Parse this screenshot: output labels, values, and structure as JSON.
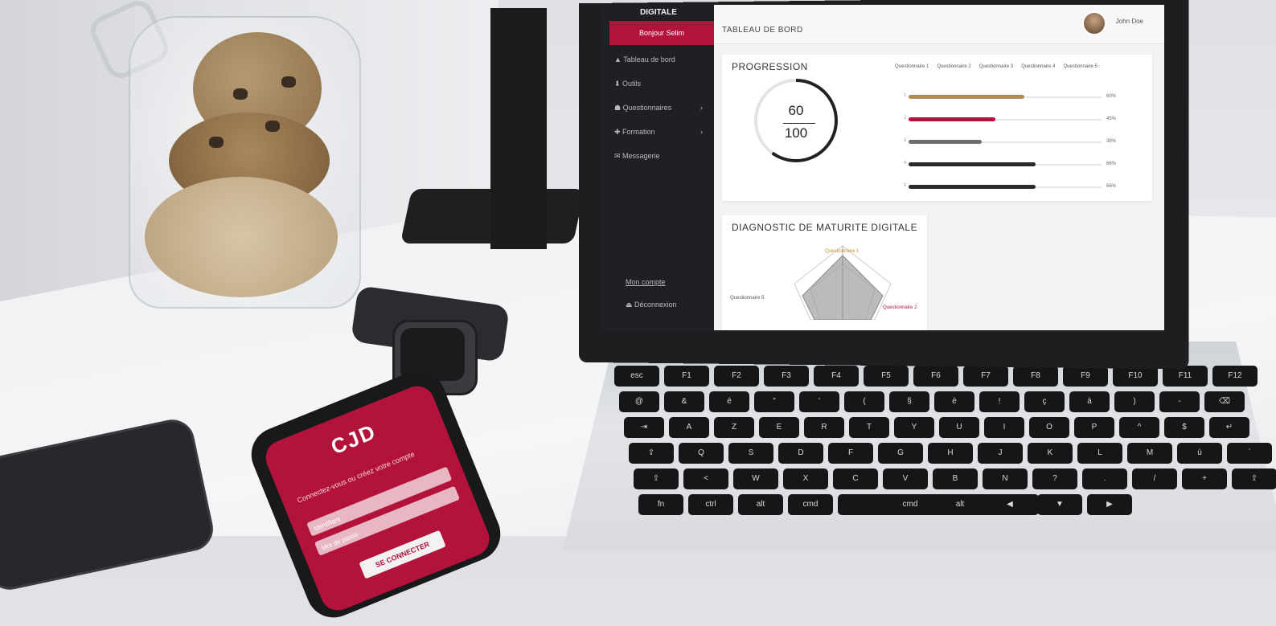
{
  "scene": {
    "colors": {
      "brand": "#b3123b",
      "sidebar": "#1f2023",
      "screen_bg": "#f3f3f4"
    }
  },
  "dashboard": {
    "brand": "DIGITALE",
    "sidebar": {
      "active_item": "Bonjour Selim",
      "items": [
        {
          "icon": "dashboard-icon",
          "label": "Tableau de bord",
          "chevron": false
        },
        {
          "icon": "download-icon",
          "label": "Outils",
          "chevron": false
        },
        {
          "icon": "user-icon",
          "label": "Questionnaires",
          "chevron": true
        },
        {
          "icon": "gift-icon",
          "label": "Formation",
          "chevron": true
        },
        {
          "icon": "message-icon",
          "label": "Messagerie",
          "chevron": false
        }
      ],
      "bottom_links": [
        "Mon compte",
        "Déconnexion"
      ]
    },
    "topbar": {
      "page_title": "TABLEAU DE BORD",
      "user_name": "John Doe"
    },
    "progression": {
      "title": "PROGRESSION",
      "score": "60",
      "total": "100",
      "score_fraction": 0.6,
      "legend": [
        "Questionnaire 1",
        "Questionnaire 2",
        "Questionnaire 3",
        "Questionnaire 4",
        "Questionnaire 5"
      ],
      "bars": [
        {
          "index": "1",
          "value": 0.6,
          "color": "#b48a55",
          "pct": "60%"
        },
        {
          "index": "2",
          "value": 0.45,
          "color": "#b3123b",
          "pct": "45%"
        },
        {
          "index": "3",
          "value": 0.38,
          "color": "#6e6e70",
          "pct": "38%"
        },
        {
          "index": "4",
          "value": 0.66,
          "color": "#2a2a2c",
          "pct": "66%"
        },
        {
          "index": "5",
          "value": 0.66,
          "color": "#2a2a2c",
          "pct": "66%"
        }
      ]
    },
    "diagnostic": {
      "title": "DIAGNOSTIC DE MATURITE DIGITALE",
      "top_label": "Questionnaire 1",
      "left_label": "Questionnaire 5",
      "right_label": "Questionnaire 2"
    }
  },
  "phone": {
    "logo": "CJD",
    "prompt": "Connectez-vous ou créez votre compte",
    "field_placeholders": [
      "Identifiant",
      "Mot de passe"
    ],
    "button": "SE CONNECTER"
  },
  "keyboard": {
    "rows": [
      [
        "esc",
        "F1",
        "F2",
        "F3",
        "F4",
        "F5",
        "F6",
        "F7",
        "F8",
        "F9",
        "F10",
        "F11",
        "F12"
      ],
      [
        "@",
        "&",
        "é",
        "\"",
        "'",
        "(",
        "§",
        "è",
        "!",
        "ç",
        "à",
        ")",
        "-",
        "⌫"
      ],
      [
        "⇥",
        "A",
        "Z",
        "E",
        "R",
        "T",
        "Y",
        "U",
        "I",
        "O",
        "P",
        "^",
        "$",
        "↵"
      ],
      [
        "⇪",
        "Q",
        "S",
        "D",
        "F",
        "G",
        "H",
        "J",
        "K",
        "L",
        "M",
        "ù",
        "`"
      ],
      [
        "⇧",
        "<",
        "W",
        "X",
        "C",
        "V",
        "B",
        "N",
        "?",
        ".",
        "/",
        "+",
        "⇧"
      ],
      [
        "fn",
        "ctrl",
        "alt",
        "cmd",
        "",
        "cmd",
        "alt",
        "◀",
        "▼",
        "▶"
      ]
    ]
  }
}
